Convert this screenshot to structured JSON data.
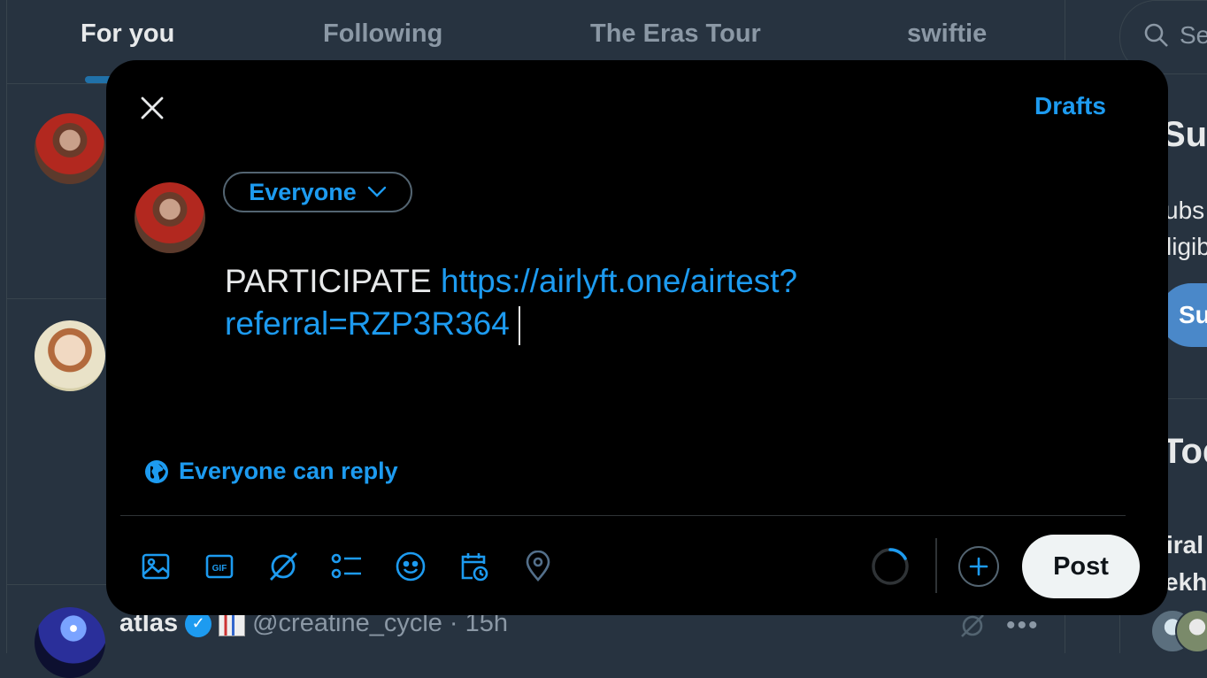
{
  "feed": {
    "tabs": [
      {
        "label": "For you",
        "active": true
      },
      {
        "label": "Following",
        "active": false
      },
      {
        "label": "The Eras Tour",
        "active": false
      },
      {
        "label": "swiftie",
        "active": false
      }
    ],
    "visible_tweet": {
      "name": "atlas",
      "handle": "@creatine_cycle",
      "separator": "·",
      "time": "15h"
    }
  },
  "right_column": {
    "search_placeholder": "Se",
    "subscribe_heading": "Sub",
    "subscribe_text_1": "ubs",
    "subscribe_text_2": "ligib",
    "subscribe_button": "Su",
    "today_heading": "Tod",
    "trend_1": "iral",
    "trend_2": "ekh"
  },
  "compose": {
    "drafts_label": "Drafts",
    "audience_label": "Everyone",
    "text_plain": "PARTICIPATE",
    "text_link_1": "https://airlyft.one/airtest?",
    "text_link_2": "referral=RZP3R364",
    "reply_setting": "Everyone can reply",
    "post_label": "Post",
    "tools": [
      "image-icon",
      "gif-icon",
      "grok-icon",
      "poll-icon",
      "emoji-icon",
      "schedule-icon",
      "location-icon"
    ]
  },
  "colors": {
    "accent": "#1d9bf0",
    "modal_bg": "#000000",
    "page_bg": "#273340"
  }
}
